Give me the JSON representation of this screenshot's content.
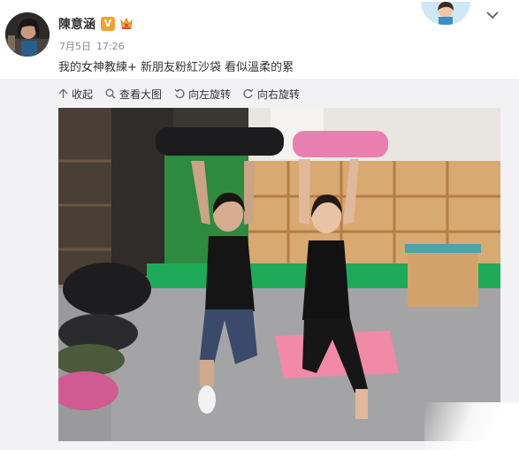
{
  "user": {
    "name": "陳意涵",
    "verified_badge": "V",
    "avatar_icon": "user-avatar-photo",
    "crown_icon": "vip-crown-icon"
  },
  "post": {
    "date": "7月5日",
    "time": "17:26",
    "text": "我的女神教練+ 新朋友粉紅沙袋 看似溫柔的累"
  },
  "toolbar": {
    "collapse_label": "收起",
    "view_large_label": "查看大图",
    "rotate_left_label": "向左旋转",
    "rotate_right_label": "向右旋转"
  },
  "colors": {
    "username": "#333333",
    "meta": "#888888",
    "badge": "#f0a22d",
    "panel_bg": "#f2f2f5",
    "pink_bag": "#e87fb0",
    "gym_floor_mat": "#f08aa8",
    "gym_green_stripe": "#1faa5a"
  }
}
